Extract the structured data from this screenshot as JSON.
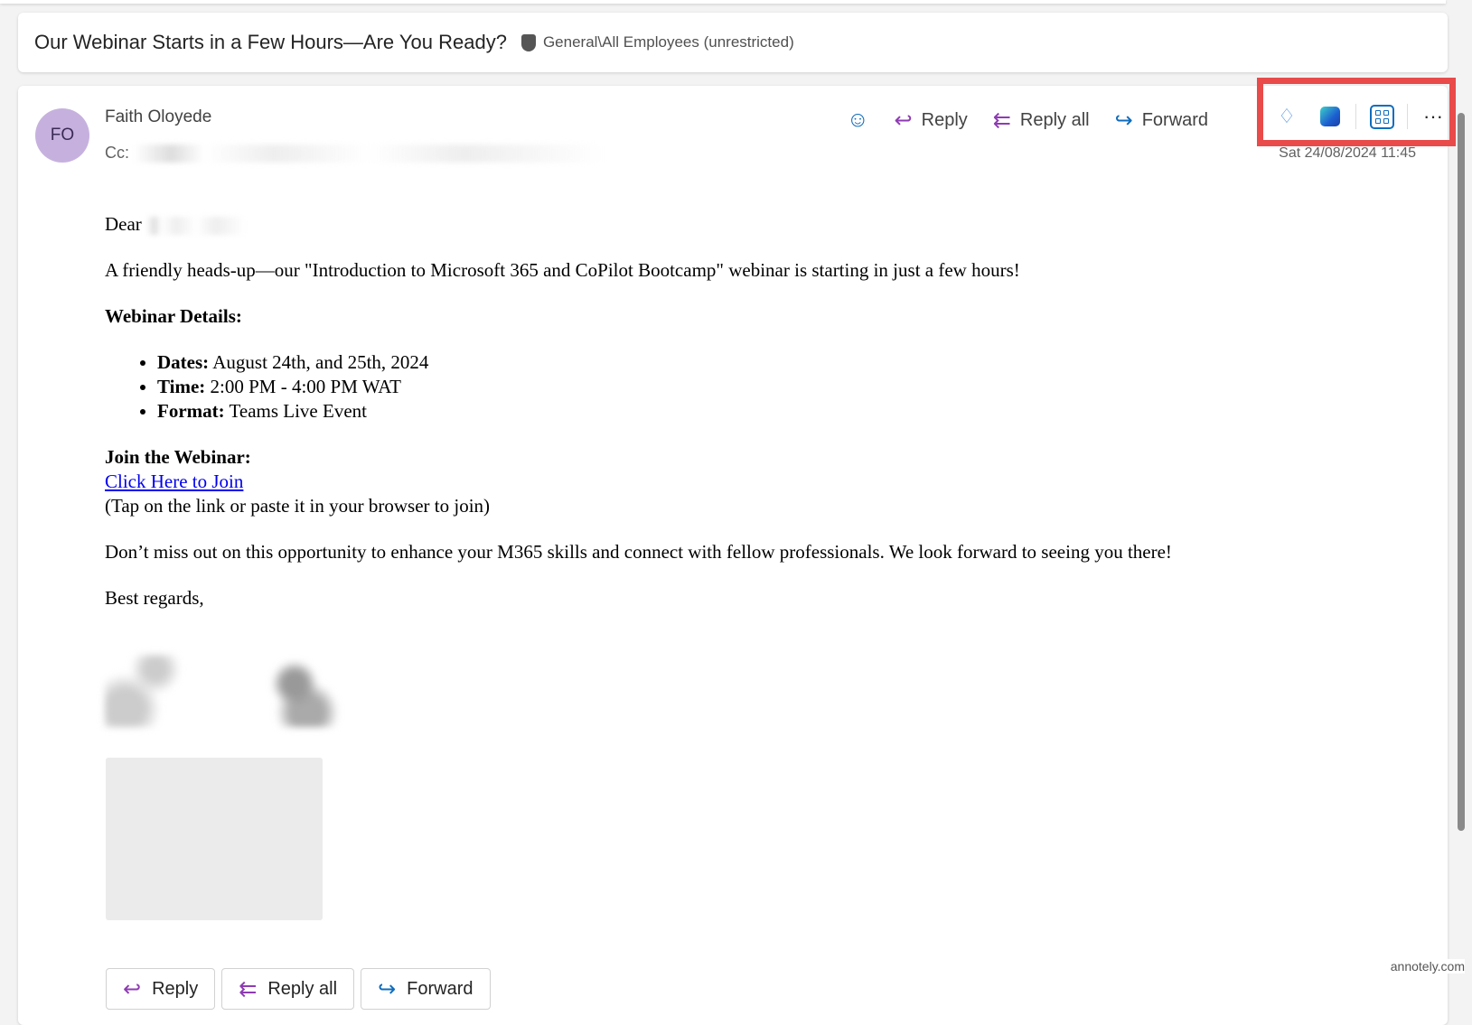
{
  "subject": {
    "title": "Our Webinar Starts in a Few Hours—Are You Ready?",
    "sensitivity": "General\\All Employees (unrestricted)"
  },
  "message": {
    "avatar": "FO",
    "sender": "Faith Oloyede",
    "cc_label": "Cc:",
    "date": "Sat 24/08/2024 11:45",
    "actions": {
      "reply": "Reply",
      "reply_all": "Reply all",
      "forward": "Forward",
      "more": "···"
    },
    "body": {
      "greeting": "Dear",
      "intro": "A friendly heads-up—our \"Introduction to Microsoft 365 and CoPilot Bootcamp\" webinar is starting in just a few hours!",
      "details_heading": "Webinar Details:",
      "details": [
        {
          "k": "Dates:",
          "v": " August 24th, and 25th, 2024"
        },
        {
          "k": "Time:",
          "v": " 2:00 PM - 4:00 PM WAT"
        },
        {
          "k": "Format:",
          "v": " Teams Live Event"
        }
      ],
      "join_heading": "Join the Webinar:",
      "join_link": "Click Here to Join",
      "join_note": "(Tap on the link or paste it in your browser to join)",
      "closing_para": "Don’t miss out on this opportunity to enhance your M365 skills and connect with fellow professionals. We look forward to seeing you there!",
      "signoff": "Best regards,"
    }
  },
  "bottom_actions": {
    "reply": "Reply",
    "reply_all": "Reply all",
    "forward": "Forward"
  },
  "watermark": "annotely.com",
  "colors": {
    "highlight": "#e94a4a",
    "avatar": "#c6b1de",
    "reply_icon": "#8e3bb3",
    "forward_icon": "#0f6cbd"
  }
}
